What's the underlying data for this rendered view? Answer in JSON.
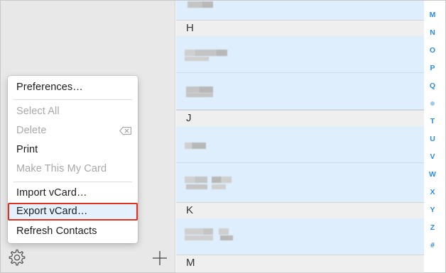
{
  "menu": {
    "items": [
      {
        "label": "Preferences…",
        "enabled": true
      },
      {
        "label": "Select All",
        "enabled": false
      },
      {
        "label": "Delete",
        "enabled": false
      },
      {
        "label": "Print",
        "enabled": true
      },
      {
        "label": "Make This My Card",
        "enabled": false
      },
      {
        "label": "Import vCard…",
        "enabled": true
      },
      {
        "label": "Export vCard…",
        "enabled": true,
        "highlighted": true
      },
      {
        "label": "Refresh Contacts",
        "enabled": true
      }
    ]
  },
  "sections": [
    "H",
    "J",
    "K",
    "M"
  ],
  "index_letters": [
    "M",
    "N",
    "O",
    "P",
    "Q",
    "T",
    "U",
    "V",
    "W",
    "X",
    "Y",
    "Z",
    "#"
  ],
  "colors": {
    "accent": "#2a8be6",
    "selected_row": "#deeefc",
    "highlight_border": "#e0301e"
  },
  "icons": {
    "settings": "gear-icon",
    "add": "plus-icon",
    "delete": "delete-key-icon"
  }
}
